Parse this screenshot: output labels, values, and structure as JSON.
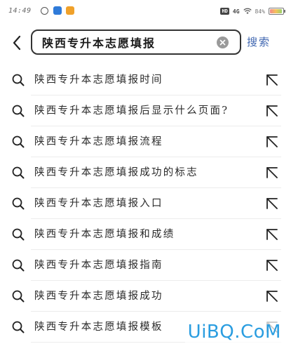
{
  "status_bar": {
    "time": "14:49",
    "net_label": "4G",
    "hd_label": "HD",
    "battery_text": "84%",
    "battery_level": 0.84
  },
  "search": {
    "query": "陕西专升本志愿填报",
    "submit_label": "搜索"
  },
  "suggestions": [
    {
      "label": "陕西专升本志愿填报时间"
    },
    {
      "label": "陕西专升本志愿填报后显示什么页面?"
    },
    {
      "label": "陕西专升本志愿填报流程"
    },
    {
      "label": "陕西专升本志愿填报成功的标志"
    },
    {
      "label": "陕西专升本志愿填报入口"
    },
    {
      "label": "陕西专升本志愿填报和成绩"
    },
    {
      "label": "陕西专升本志愿填报指南"
    },
    {
      "label": "陕西专升本志愿填报成功"
    },
    {
      "label": "陕西专升本志愿填报模板"
    }
  ],
  "watermark": "UiBQ.CoM",
  "icons": {
    "back": "chevron-left-icon",
    "clear": "clear-icon",
    "row_search": "search-icon",
    "row_fill": "arrow-up-left-icon"
  },
  "colors": {
    "accent": "#3f66b0",
    "watermark": "#2a9de0",
    "clear_bg": "#9a9a9a"
  }
}
